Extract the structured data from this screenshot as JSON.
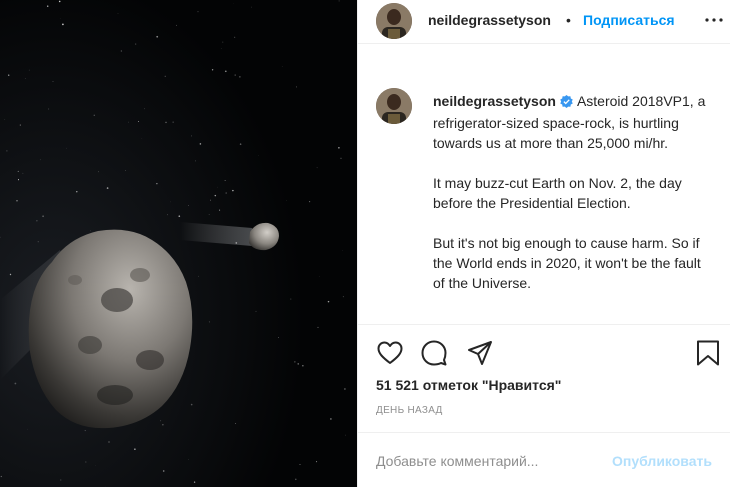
{
  "post": {
    "image_alt_icon": "asteroid-photo",
    "author": "neildegrassetyson",
    "separator": "•",
    "follow_label": "Подписаться",
    "more_icon": "more-horizontal-icon"
  },
  "caption": {
    "username": "neildegrassetyson",
    "paragraph_1": "Asteroid 2018VP1, a refrigerator-sized space-rock, is hurtling towards us at more than 25,000 mi/hr.",
    "paragraph_2": "It may buzz-cut Earth on Nov. 2, the day before the Presidential Election.",
    "paragraph_3": "But it's not big enough to cause harm. So if the World ends in 2020, it won't be the fault of the Universe."
  },
  "actions": {
    "like_icon": "heart-icon",
    "comment_icon": "comment-icon",
    "share_icon": "share-icon",
    "save_icon": "bookmark-icon",
    "likes_text": "51 521 отметок \"Нравится\"",
    "timestamp": "ДЕНЬ НАЗАД"
  },
  "comment": {
    "placeholder": "Добавьте комментарий...",
    "publish_label": "Опубликовать"
  },
  "colors": {
    "accent": "#0095f6",
    "publish_disabled": "#b2dffc",
    "verified": "#3897f0"
  }
}
